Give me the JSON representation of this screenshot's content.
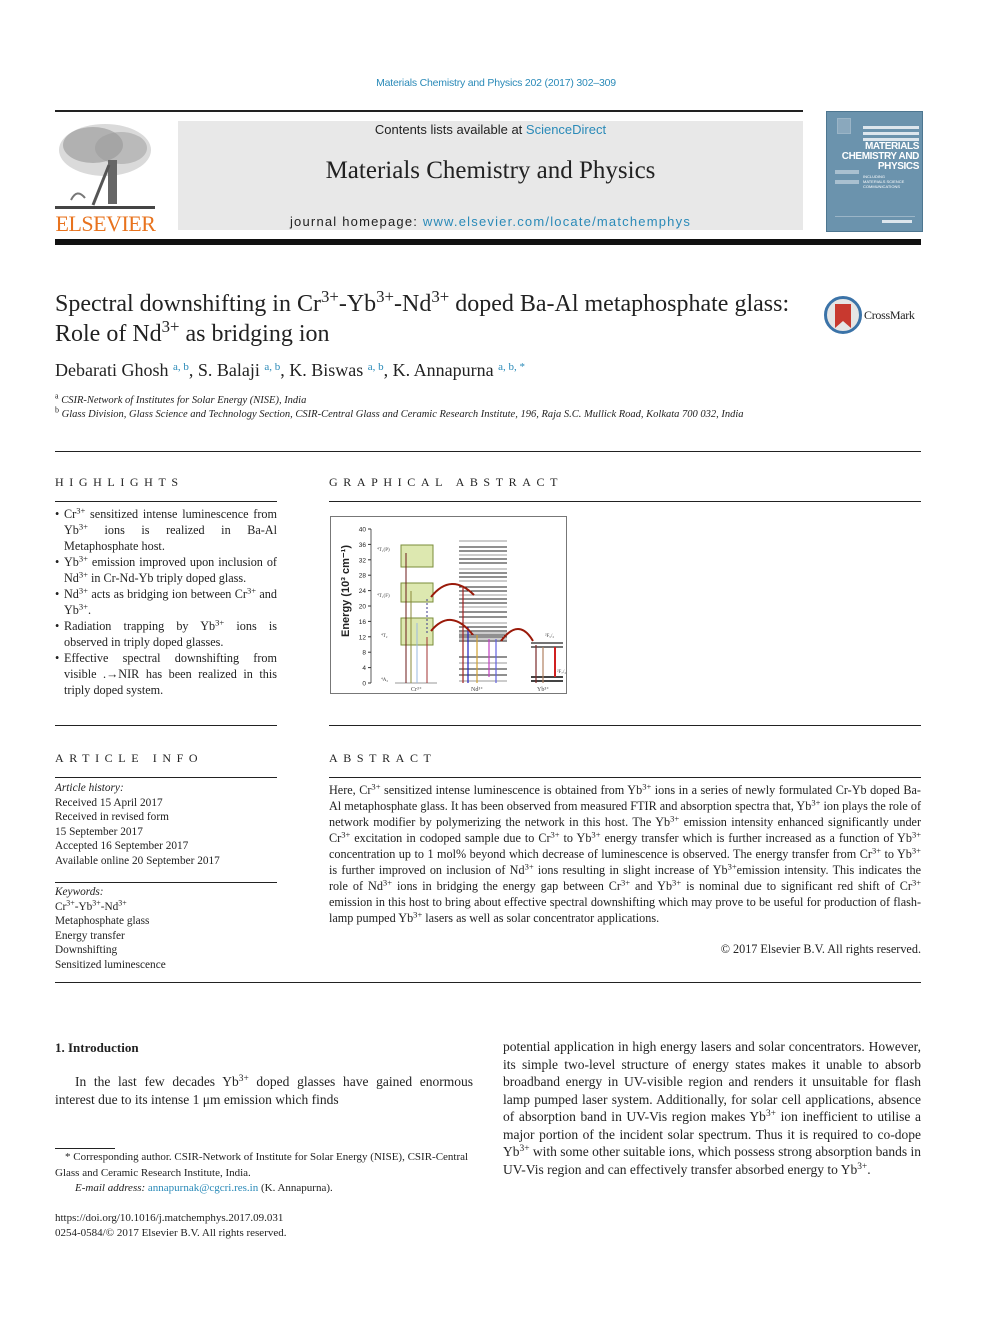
{
  "header": {
    "citation": "Materials Chemistry and Physics 202 (2017) 302–309",
    "contents_prefix": "Contents lists available at ",
    "contents_link": "ScienceDirect",
    "journal_title": "Materials Chemistry and Physics",
    "homepage_prefix": "journal homepage: ",
    "homepage_link": "www.elsevier.com/locate/matchemphys",
    "publisher_logo_text": "ELSEVIER",
    "cover": {
      "line1": "MATERIALS",
      "line2": "CHEMISTRY AND",
      "line3": "PHYSICS",
      "sub1": "INCLUDING",
      "sub2": "MATERIALS SCIENCE",
      "sub3": "COMMUNICATIONS"
    },
    "crossmark_label": "CrossMark"
  },
  "article": {
    "title_parts": [
      "Spectral downshifting in Cr",
      "3+",
      "-Yb",
      "3+",
      "-Nd",
      "3+",
      " doped Ba-Al metaphosphate glass: Role of Nd",
      "3+",
      " as bridging ion"
    ],
    "authors": [
      {
        "name": "Debarati Ghosh",
        "aff": "a, b"
      },
      {
        "name": "S. Balaji",
        "aff": "a, b"
      },
      {
        "name": "K. Biswas",
        "aff": "a, b"
      },
      {
        "name": "K. Annapurna",
        "aff": "a, b, *"
      }
    ],
    "affiliations": [
      {
        "mark": "a",
        "text": "CSIR-Network of Institutes for Solar Energy (NISE), India"
      },
      {
        "mark": "b",
        "text": "Glass Division, Glass Science and Technology Section, CSIR-Central Glass and Ceramic Research Institute, 196, Raja S.C. Mullick Road, Kolkata 700 032, India"
      }
    ]
  },
  "highlights": {
    "heading": "HIGHLIGHTS",
    "bullet": "•",
    "items": [
      [
        "Cr",
        "3+",
        " sensitized intense luminescence from Yb",
        "3+",
        " ions is realized in Ba-Al Metaphosphate host."
      ],
      [
        "Yb",
        "3+",
        " emission improved upon inclusion of Nd",
        "3+",
        " in Cr-Nd-Yb triply doped glass."
      ],
      [
        "Nd",
        "3+",
        " acts as bridging ion between Cr",
        "3+",
        " and Yb",
        "3+",
        "."
      ],
      [
        "Radiation trapping by Yb",
        "3+",
        " ions is observed in triply doped glasses."
      ],
      [
        "Effective spectral downshifting from visible .→NIR has been realized in this triply doped system."
      ]
    ]
  },
  "graphical_abstract": {
    "heading": "GRAPHICAL ABSTRACT",
    "y_label": "Energy (10³ cm⁻¹)",
    "y_ticks": [
      "0",
      "4",
      "8",
      "12",
      "16",
      "20",
      "24",
      "28",
      "32",
      "36",
      "40"
    ],
    "ions": [
      "Cr³⁺",
      "Nd³⁺",
      "Yb³⁺"
    ],
    "cr_levels": [
      "⁴T₁(P)",
      "⁴T₁(F)",
      "⁴T₂",
      "⁴A₂"
    ],
    "yb_levels": [
      "²F₅/₂",
      "²F₇/₂"
    ]
  },
  "article_info": {
    "heading": "ARTICLE INFO",
    "history_label": "Article history:",
    "history": [
      "Received 15 April 2017",
      "Received in revised form",
      "15 September 2017",
      "Accepted 16 September 2017",
      "Available online 20 September 2017"
    ],
    "keywords_label": "Keywords:",
    "keywords_first": [
      "Cr",
      "3+",
      "-Yb",
      "3+",
      "-Nd",
      "3+"
    ],
    "keywords": [
      "Metaphosphate glass",
      "Energy transfer",
      "Downshifting",
      "Sensitized luminescence"
    ]
  },
  "abstract": {
    "heading": "ABSTRACT",
    "parts": [
      "Here, Cr",
      "3+",
      " sensitized intense luminescence is obtained from Yb",
      "3+",
      " ions in a series of newly formulated Cr-Yb doped Ba-Al metaphosphate glass. It has been observed from measured FTIR and absorption spectra that, Yb",
      "3+",
      " ion plays the role of network modifier by polymerizing the network in this host. The Yb",
      "3+",
      " emission intensity enhanced significantly under Cr",
      "3+",
      " excitation in codoped sample due to Cr",
      "3+",
      " to Yb",
      "3+",
      " energy transfer which is further increased as a function of Yb",
      "3+",
      " concentration up to 1 mol% beyond which decrease of luminescence is observed. The energy transfer from Cr",
      "3+",
      " to Yb",
      "3+",
      " is further improved on inclusion of Nd",
      "3+",
      " ions resulting in slight increase of Yb",
      "3+",
      "emission intensity. This indicates the role of Nd",
      "3+",
      " ions in bridging the energy gap between Cr",
      "3+",
      " and Yb",
      "3+",
      " is nominal due to significant red shift of Cr",
      "3+",
      " emission in this host to bring about effective spectral downshifting which may prove to be useful for production of flash-lamp pumped Yb",
      "3+",
      " lasers as well as solar concentrator applications."
    ],
    "copyright": "© 2017 Elsevier B.V. All rights reserved."
  },
  "introduction": {
    "heading": "1.  Introduction",
    "left_parts": [
      "In the last few decades Yb",
      "3+",
      " doped glasses have gained enormous interest due to its intense 1 μm emission which finds"
    ],
    "right_parts": [
      "potential application in high energy lasers and solar concentrators. However, its simple two-level structure of energy states makes it unable to absorb broadband energy in UV-visible region and renders it unsuitable for flash lamp pumped laser system. Additionally, for solar cell applications, absence of absorption band in UV-Vis region makes Yb",
      "3+",
      " ion inefficient to utilise a major portion of the incident solar spectrum. Thus it is required to co-dope Yb",
      "3+",
      " with some other suitable ions, which possess strong absorption bands in UV-Vis region and can effectively transfer absorbed energy to Yb",
      "3+",
      "."
    ]
  },
  "footnotes": {
    "corresponding": "* Corresponding author. CSIR-Network of Institute for Solar Energy (NISE), CSIR-Central Glass and Ceramic Research Institute, India.",
    "email_label": "E-mail address: ",
    "email": "annapurnak@cgcri.res.in",
    "email_suffix": " (K. Annapurna).",
    "doi": "https://doi.org/10.1016/j.matchemphys.2017.09.031",
    "issn": "0254-0584/© 2017 Elsevier B.V. All rights reserved."
  }
}
